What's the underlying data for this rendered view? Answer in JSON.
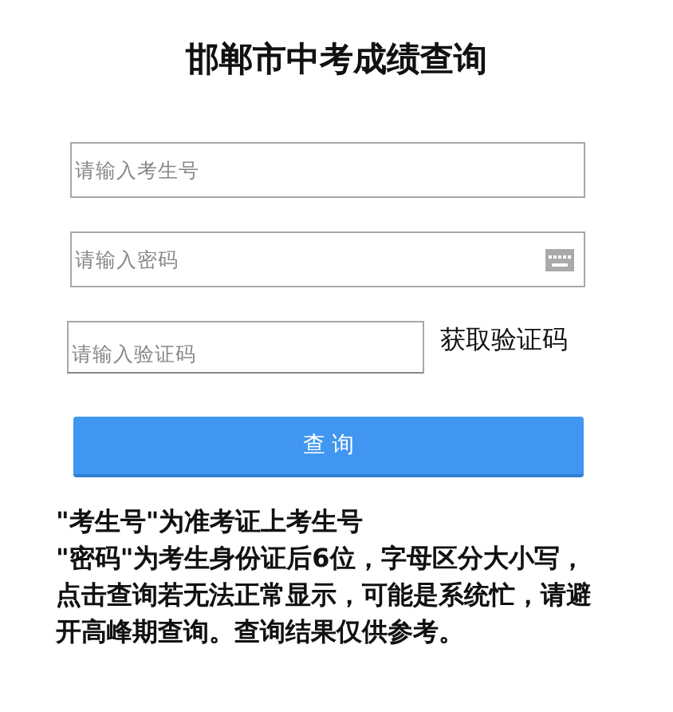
{
  "title": "邯郸市中考成绩查询",
  "fields": [
    {
      "kind": "text",
      "placeholder": "请输入考生号"
    },
    {
      "kind": "password",
      "placeholder": "请输入密码"
    }
  ],
  "captcha": {
    "placeholder": "请输入验证码",
    "link": "获取验证码"
  },
  "submit": "查 询",
  "notes": [
    "\"考生号\"为准考证上考生号",
    "\"密码\"为考生身份证后6位，字母区分大小写，",
    "点击查询若无法正常显示，可能是系统忙，请避",
    "开高峰期查询。查询结果仅供参考。"
  ]
}
